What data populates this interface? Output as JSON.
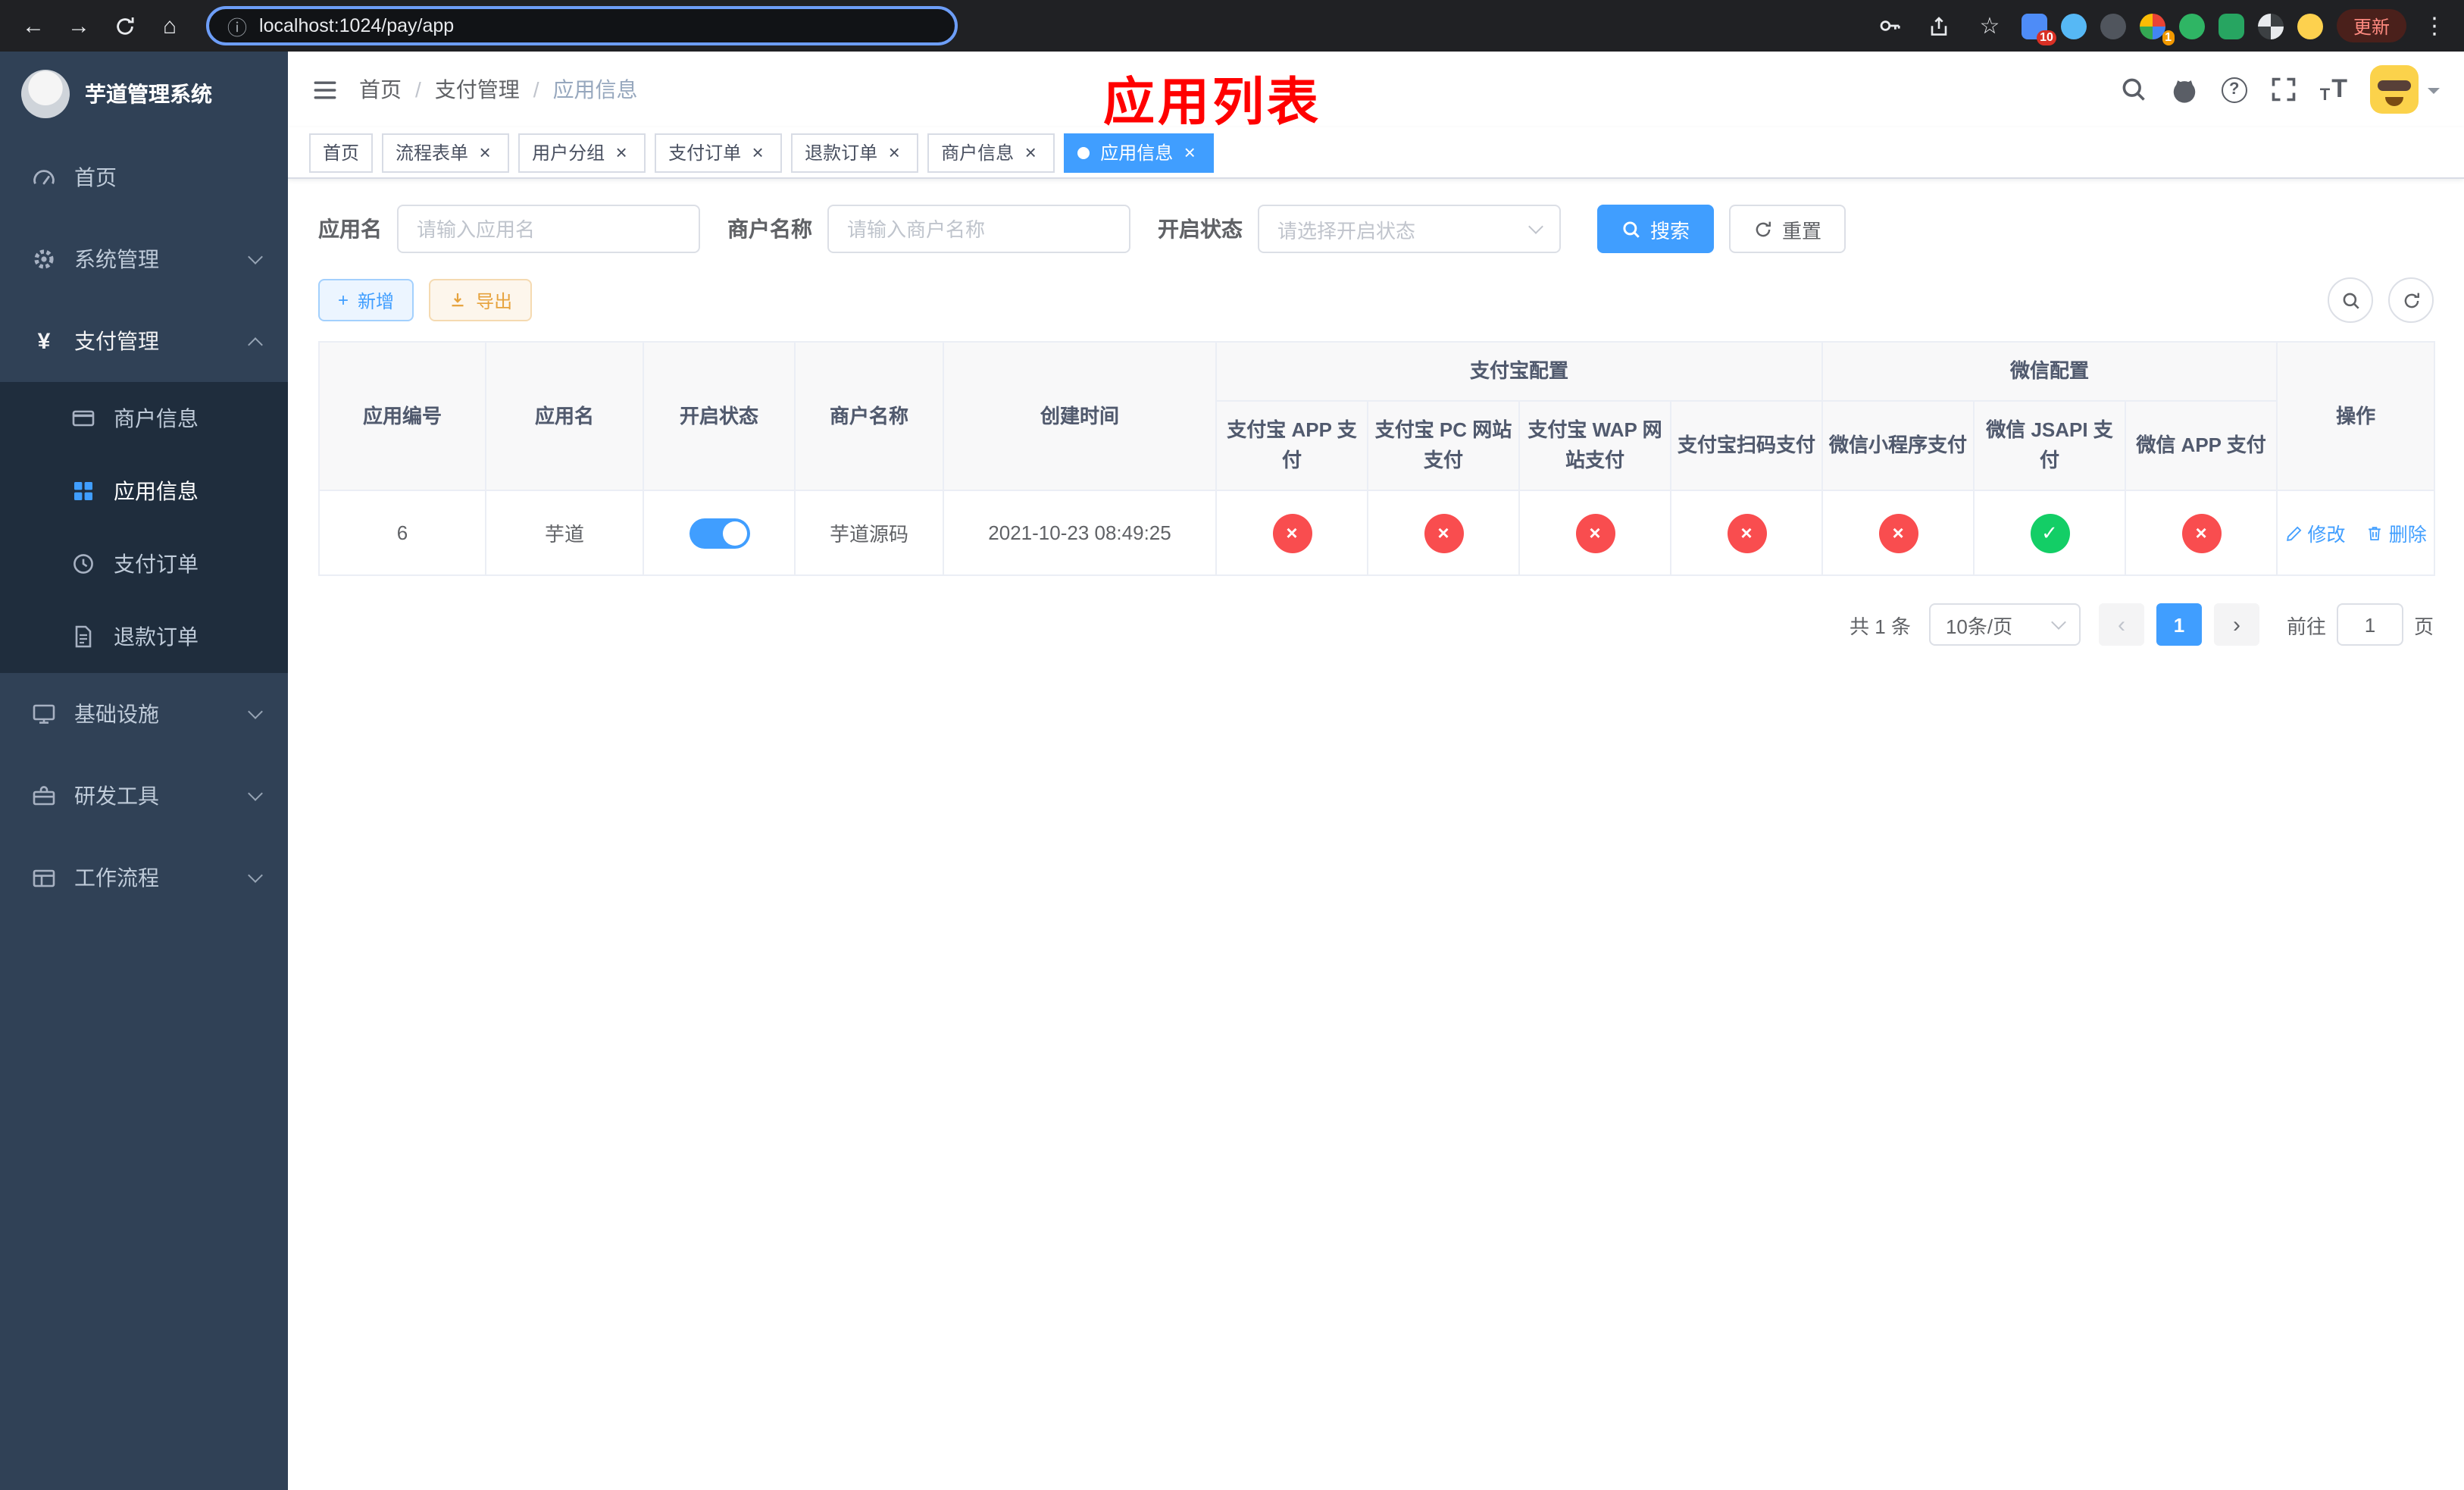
{
  "browser": {
    "url": "localhost:1024/pay/app",
    "update_label": "更新",
    "ext_badge_a": "10",
    "ext_badge_b": "1"
  },
  "glyphs": {
    "back": "←",
    "forward": "→",
    "home": "⌂",
    "info": "ⓘ",
    "star": "☆",
    "more": "⋮",
    "close": "×",
    "cross": "×",
    "check": "✓",
    "plus": "+",
    "help": "?",
    "prev": "‹",
    "next": "›",
    "size_large": "T",
    "size_small": "T"
  },
  "sidebar": {
    "app_title": "芋道管理系统",
    "menu_top": [
      {
        "label": "首页"
      },
      {
        "label": "系统管理"
      },
      {
        "label": "支付管理"
      }
    ],
    "submenu": [
      {
        "label": "商户信息"
      },
      {
        "label": "应用信息"
      },
      {
        "label": "支付订单"
      },
      {
        "label": "退款订单"
      }
    ],
    "menu_bottom": [
      {
        "label": "基础设施"
      },
      {
        "label": "研发工具"
      },
      {
        "label": "工作流程"
      }
    ]
  },
  "header": {
    "breadcrumb": [
      "首页",
      "支付管理",
      "应用信息"
    ],
    "separator": "/",
    "annotation": "应用列表"
  },
  "tabs": [
    {
      "label": "首页"
    },
    {
      "label": "流程表单"
    },
    {
      "label": "用户分组"
    },
    {
      "label": "支付订单"
    },
    {
      "label": "退款订单"
    },
    {
      "label": "商户信息"
    },
    {
      "label": "应用信息"
    }
  ],
  "filters": {
    "app_name_label": "应用名",
    "app_name_placeholder": "请输入应用名",
    "merchant_label": "商户名称",
    "merchant_placeholder": "请输入商户名称",
    "status_label": "开启状态",
    "status_placeholder": "请选择开启状态",
    "search_label": "搜索",
    "reset_label": "重置"
  },
  "toolbar": {
    "add_label": "新增",
    "export_label": "导出"
  },
  "table": {
    "headers": {
      "id": "应用编号",
      "name": "应用名",
      "status": "开启状态",
      "merchant": "商户名称",
      "created": "创建时间",
      "alipay_group": "支付宝配置",
      "wechat_group": "微信配置",
      "alipay_app": "支付宝 APP 支付",
      "alipay_pc": "支付宝 PC 网站支付",
      "alipay_wap": "支付宝 WAP 网站支付",
      "alipay_qr": "支付宝扫码支付",
      "wx_mini": "微信小程序支付",
      "wx_jsapi": "微信 JSAPI 支付",
      "wx_app": "微信 APP 支付",
      "actions": "操作"
    },
    "row": {
      "id": "6",
      "name": "芋道",
      "status_on": true,
      "merchant": "芋道源码",
      "created": "2021-10-23 08:49:25",
      "channels": {
        "alipay_app": false,
        "alipay_pc": false,
        "alipay_wap": false,
        "alipay_qr": false,
        "wx_mini": false,
        "wx_jsapi": true,
        "wx_app": false
      },
      "edit_label": "修改",
      "delete_label": "删除"
    }
  },
  "pagination": {
    "total_text": "共 1 条",
    "page_size": "10条/页",
    "current_page": "1",
    "goto_prefix": "前往",
    "goto_value": "1",
    "goto_suffix": "页"
  },
  "colors": {
    "primary": "#409EFF",
    "success": "#13ce66",
    "danger": "#f94d4f",
    "warning": "#e6a23c",
    "annotation": "#ff0000",
    "sidebar_bg": "#304156",
    "submenu_bg": "#1f2d3d"
  }
}
